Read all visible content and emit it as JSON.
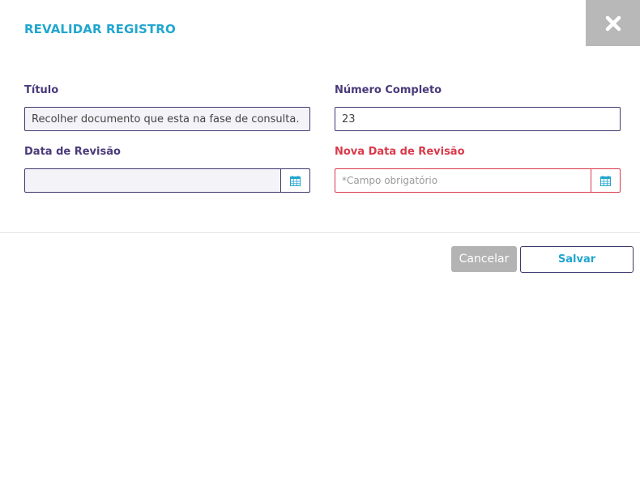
{
  "modal": {
    "title": "REVALIDAR REGISTRO",
    "close_icon": "close-icon"
  },
  "form": {
    "titulo": {
      "label": "Título",
      "value": "Recolher documento que esta na fase de consulta."
    },
    "numero_completo": {
      "label": "Número Completo",
      "value": "23"
    },
    "data_revisao": {
      "label": "Data de Revisão",
      "value": "",
      "icon": "calendar-icon"
    },
    "nova_data_revisao": {
      "label": "Nova Data de Revisão",
      "placeholder": "*Campo obrigatório",
      "value": "",
      "icon": "calendar-icon",
      "required": true
    }
  },
  "actions": {
    "cancel_label": "Cancelar",
    "save_label": "Salvar"
  },
  "colors": {
    "accent": "#21a6cf",
    "label": "#4a3a7a",
    "error": "#d93a4a",
    "border": "#3d3a6e",
    "close_bg": "#b8b8b8",
    "cancel_bg": "#b3b3b3"
  }
}
